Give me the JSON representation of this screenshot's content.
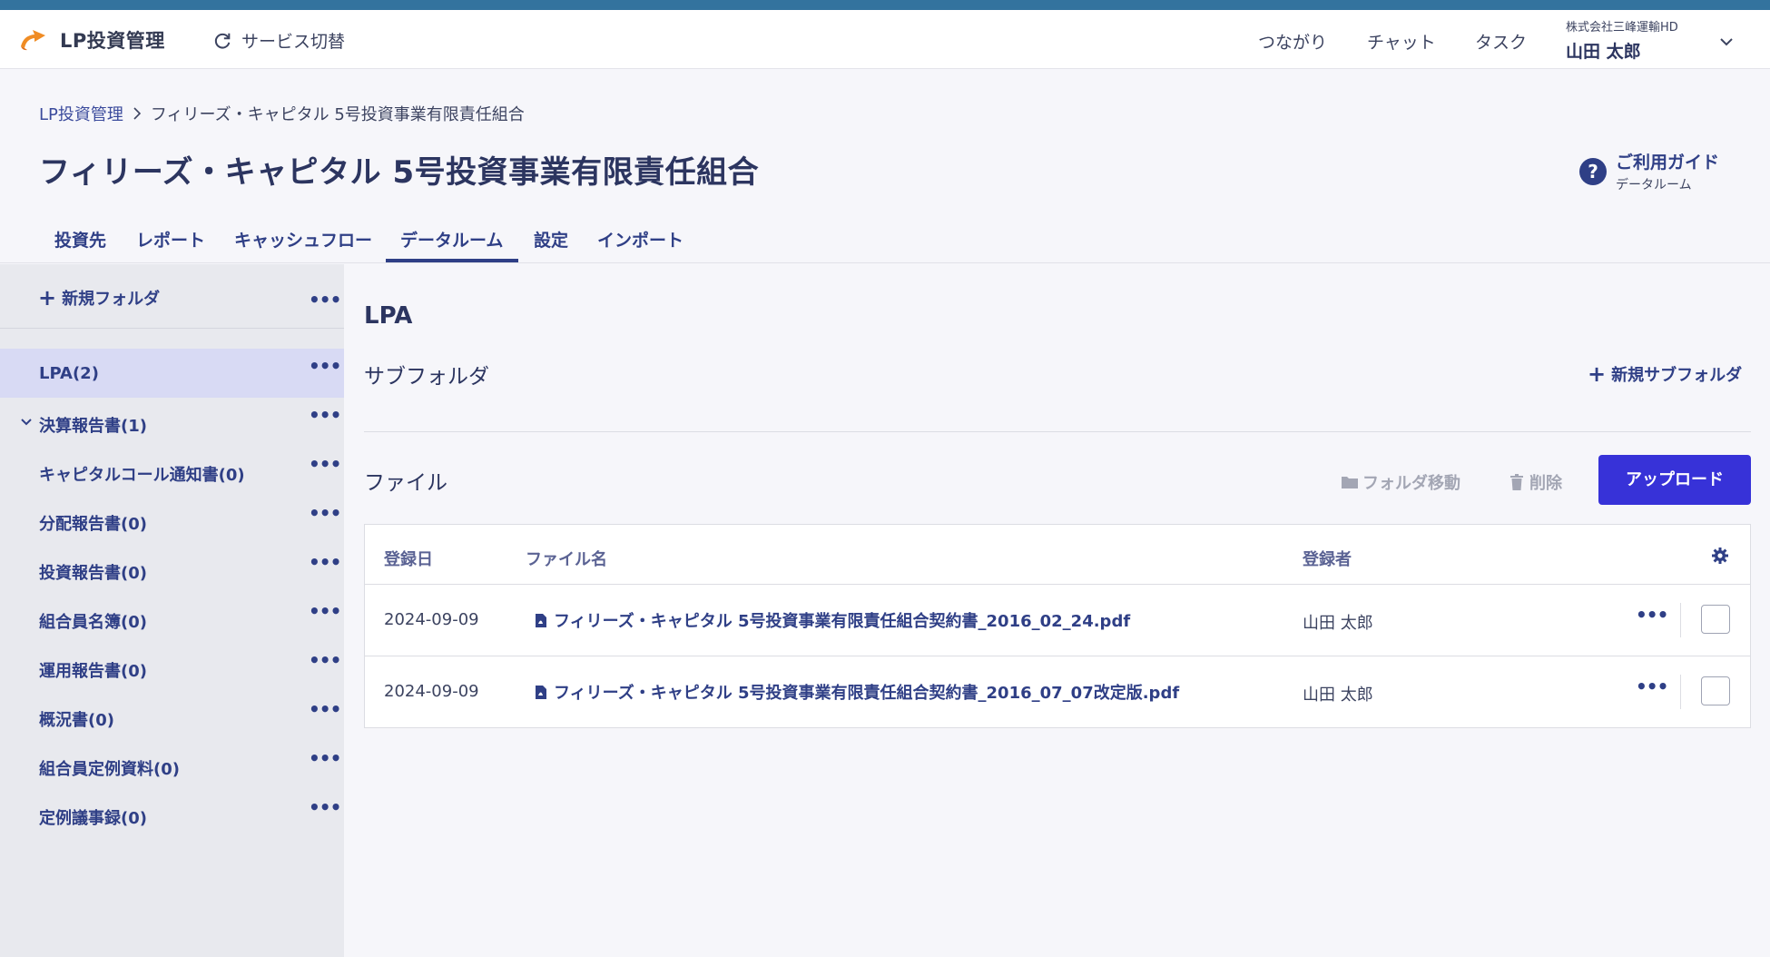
{
  "header": {
    "brand": "LP投資管理",
    "service_switch": "サービス切替",
    "nav": [
      "つながり",
      "チャット",
      "タスク"
    ],
    "company": "株式会社三峰運輸HD",
    "user": "山田 太郎"
  },
  "breadcrumb": {
    "root": "LP投資管理",
    "current": "フィリーズ・キャピタル 5号投資事業有限責任組合"
  },
  "page_title": "フィリーズ・キャピタル 5号投資事業有限責任組合",
  "guide": {
    "title": "ご利用ガイド",
    "subtitle": "データルーム"
  },
  "tabs": [
    "投資先",
    "レポート",
    "キャッシュフロー",
    "データルーム",
    "設定",
    "インポート"
  ],
  "active_tab": "データルーム",
  "sidebar": {
    "new_folder": "新規フォルダ",
    "items": [
      {
        "label": "LPA(2)",
        "selected": true
      },
      {
        "label": "決算報告書(1)",
        "expanded": true
      },
      {
        "label": "キャピタルコール通知書(0)"
      },
      {
        "label": "分配報告書(0)"
      },
      {
        "label": "投資報告書(0)"
      },
      {
        "label": "組合員名簿(0)"
      },
      {
        "label": "運用報告書(0)"
      },
      {
        "label": "概況書(0)"
      },
      {
        "label": "組合員定例資料(0)"
      },
      {
        "label": "定例議事録(0)"
      }
    ]
  },
  "main": {
    "folder_title": "LPA",
    "subfolder_label": "サブフォルダ",
    "new_subfolder": "新規サブフォルダ",
    "file_label": "ファイル",
    "move_label": "フォルダ移動",
    "delete_label": "削除",
    "upload_label": "アップロード",
    "table": {
      "headers": [
        "登録日",
        "ファイル名",
        "登録者"
      ],
      "rows": [
        {
          "date": "2024-09-09",
          "name": "フィリーズ・キャピタル 5号投資事業有限責任組合契約書_2016_02_24.pdf",
          "owner": "山田 太郎"
        },
        {
          "date": "2024-09-09",
          "name": "フィリーズ・キャピタル 5号投資事業有限責任組合契約書_2016_07_07改定版.pdf",
          "owner": "山田 太郎"
        }
      ]
    }
  },
  "colors": {
    "accent_bar": "#33739e",
    "primary": "#2f3f86",
    "upload_button": "#3732d8",
    "sidebar_bg": "#e8e9ee",
    "selected_bg": "#d8daf4"
  }
}
